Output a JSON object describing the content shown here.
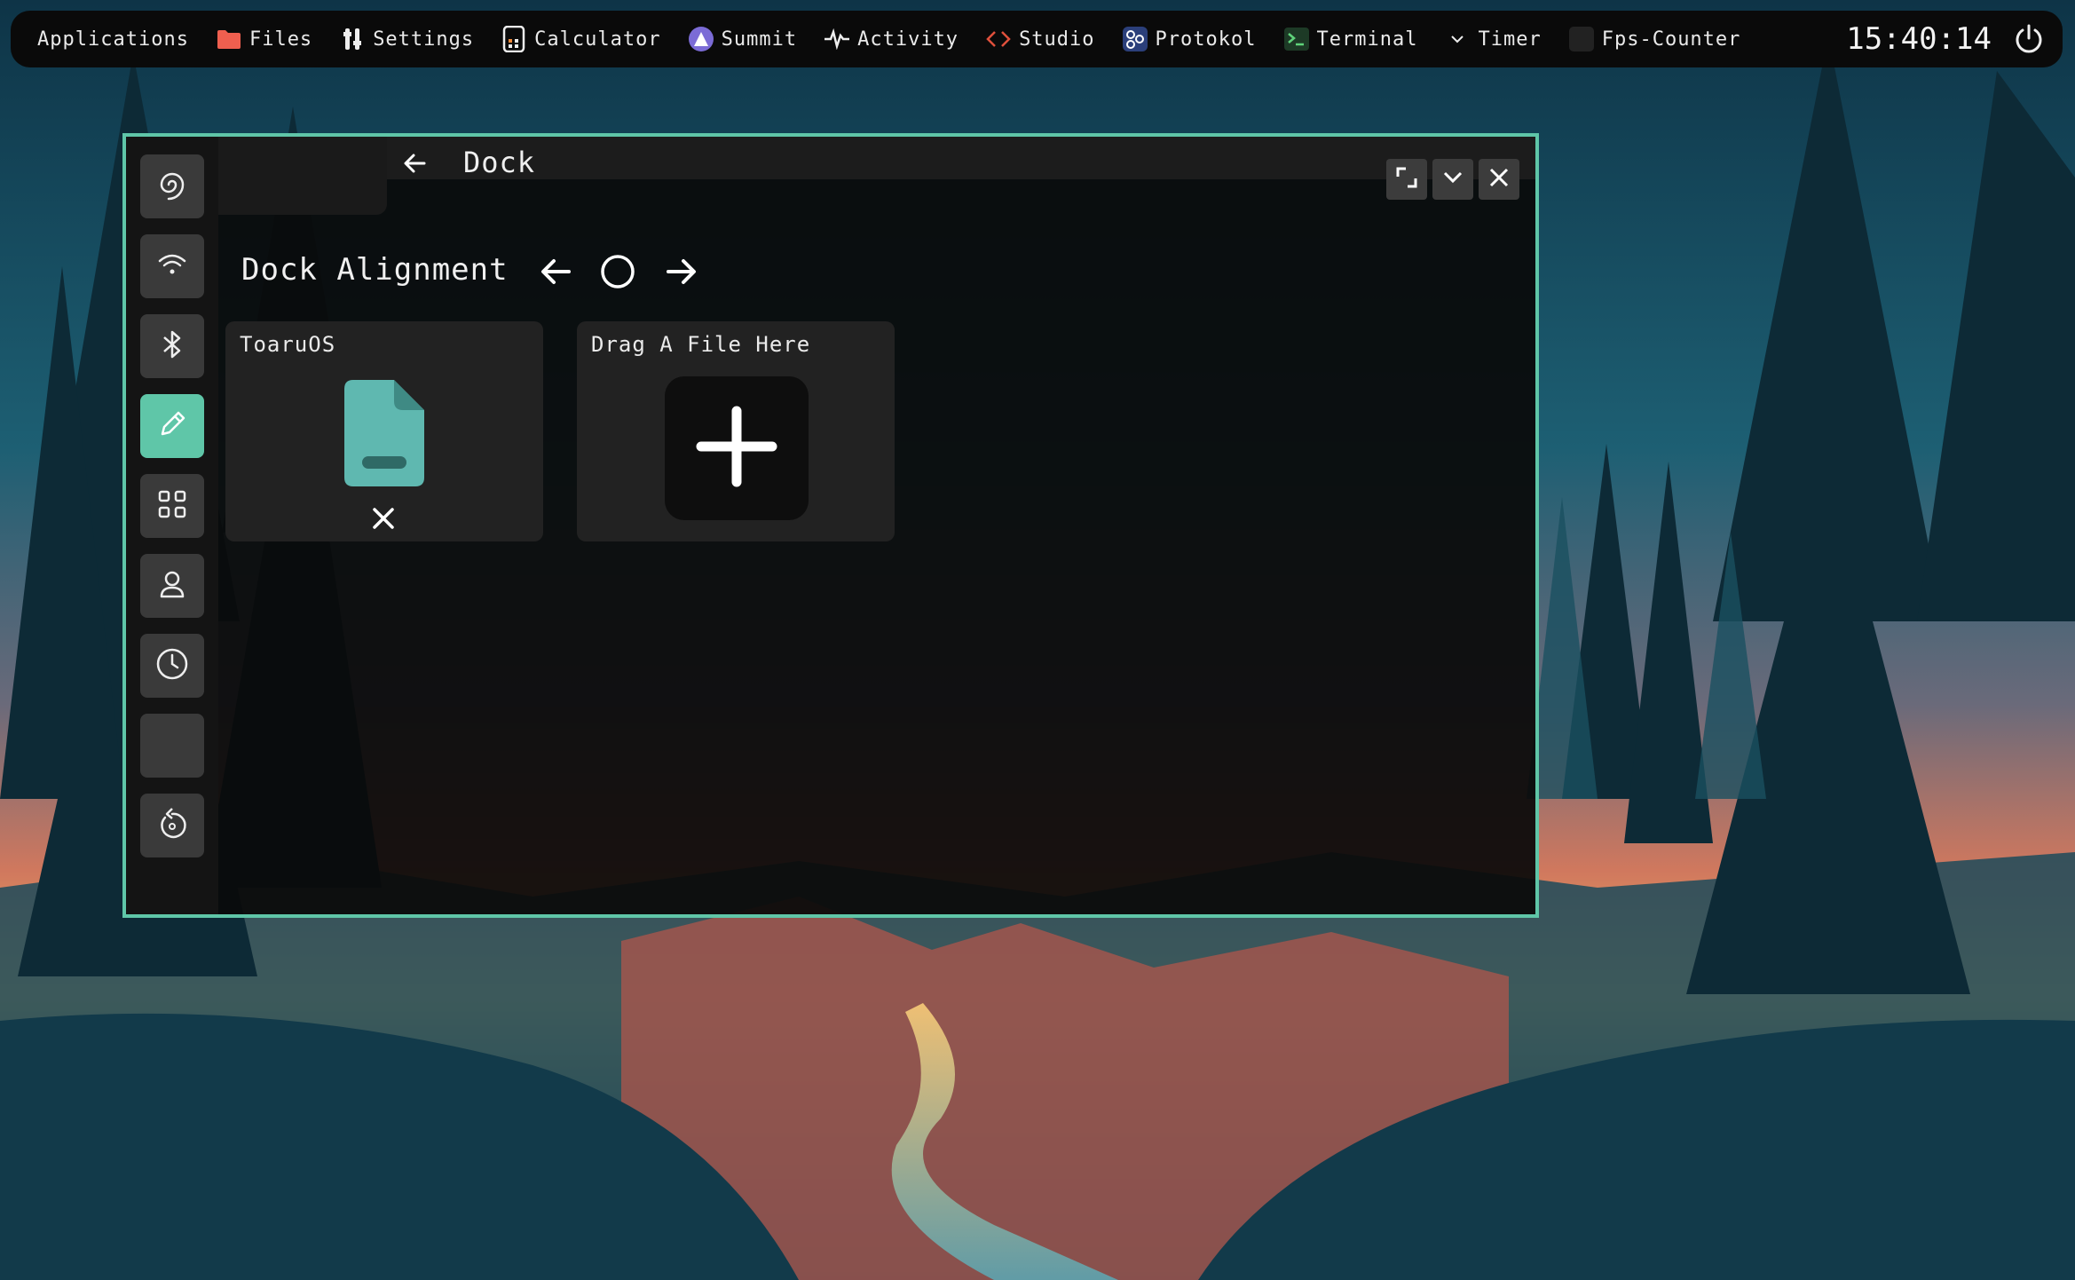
{
  "panel": {
    "items": [
      {
        "label": "Applications",
        "icon": "none"
      },
      {
        "label": "Files",
        "icon": "folder-icon"
      },
      {
        "label": "Settings",
        "icon": "settings-icon"
      },
      {
        "label": "Calculator",
        "icon": "calculator-icon"
      },
      {
        "label": "Summit",
        "icon": "summit-icon"
      },
      {
        "label": "Activity",
        "icon": "activity-icon"
      },
      {
        "label": "Studio",
        "icon": "code-icon"
      },
      {
        "label": "Protokol",
        "icon": "share-icon"
      },
      {
        "label": "Terminal",
        "icon": "terminal-icon"
      },
      {
        "label": "Timer",
        "icon": "chevron-down-icon"
      },
      {
        "label": "Fps-Counter",
        "icon": "blank-icon"
      }
    ],
    "clock": "15:40:14",
    "power_icon": "power-icon"
  },
  "window": {
    "title": "Dock",
    "accent": "#5fc6a8",
    "sidebar": [
      {
        "name": "appearance",
        "icon": "spiral-icon",
        "active": false
      },
      {
        "name": "wifi",
        "icon": "wifi-icon",
        "active": false
      },
      {
        "name": "bluetooth",
        "icon": "bluetooth-icon",
        "active": false
      },
      {
        "name": "customize",
        "icon": "pencil-icon",
        "active": true
      },
      {
        "name": "apps",
        "icon": "grid-icon",
        "active": false
      },
      {
        "name": "users",
        "icon": "user-icon",
        "active": false
      },
      {
        "name": "time",
        "icon": "clock-icon",
        "active": false
      },
      {
        "name": "empty",
        "icon": "blank-icon",
        "active": false
      },
      {
        "name": "reset",
        "icon": "reset-icon",
        "active": false
      }
    ],
    "section_title": "Dock Alignment",
    "alignment": {
      "left_icon": "arrow-left-icon",
      "center_icon": "circle-icon",
      "right_icon": "arrow-right-icon"
    },
    "cards": [
      {
        "label": "ToaruOS",
        "icon": "file-icon",
        "remove_icon": "close-icon"
      },
      {
        "label": "Drag A File Here",
        "icon": "plus-icon"
      }
    ]
  }
}
